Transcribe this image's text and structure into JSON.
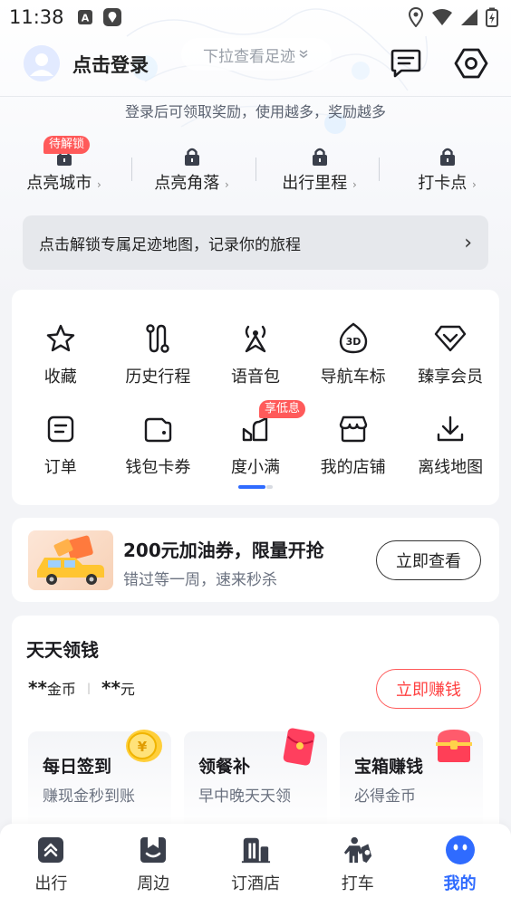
{
  "status_bar": {
    "time": "11:38"
  },
  "header": {
    "login_label": "点击登录",
    "pull_hint": "下拉查看足迹"
  },
  "login_hint": "登录后可领取奖励，使用越多，奖励越多",
  "unlock_tag": "待解锁",
  "stats": [
    {
      "label": "点亮城市"
    },
    {
      "label": "点亮角落"
    },
    {
      "label": "出行里程"
    },
    {
      "label": "打卡点"
    }
  ],
  "unlock_banner": "点击解锁专属足迹地图，记录你的旅程",
  "grid": [
    {
      "label": "收藏",
      "icon": "star-icon"
    },
    {
      "label": "历史行程",
      "icon": "route-icon"
    },
    {
      "label": "语音包",
      "icon": "voice-pack-icon"
    },
    {
      "label": "导航车标",
      "icon": "3d-car-icon"
    },
    {
      "label": "臻享会员",
      "icon": "diamond-icon"
    },
    {
      "label": "订单",
      "icon": "order-icon"
    },
    {
      "label": "钱包卡券",
      "icon": "wallet-icon"
    },
    {
      "label": "度小满",
      "icon": "duxiaoman-icon"
    },
    {
      "label": "我的店铺",
      "icon": "store-icon"
    },
    {
      "label": "离线地图",
      "icon": "download-icon"
    }
  ],
  "low_tag": "享低息",
  "promo": {
    "title": "200元加油券，限量开抢",
    "subtitle": "错过等一周，速来秒杀",
    "button": "立即查看"
  },
  "earn": {
    "title": "天天领钱",
    "coins_value": "**",
    "coins_unit": "金币",
    "cash_value": "**",
    "cash_unit": "元",
    "button": "立即赚钱",
    "tasks": [
      {
        "title": "每日签到",
        "subtitle": "赚现金秒到账",
        "icon": "gold-coin-icon"
      },
      {
        "title": "领餐补",
        "subtitle": "早中晚天天领",
        "icon": "red-envelope-icon"
      },
      {
        "title": "宝箱赚钱",
        "subtitle": "必得金币",
        "icon": "treasure-chest-icon"
      }
    ]
  },
  "tabs": [
    {
      "label": "出行",
      "icon": "travel-icon"
    },
    {
      "label": "周边",
      "icon": "nearby-icon"
    },
    {
      "label": "订酒店",
      "icon": "hotel-icon"
    },
    {
      "label": "打车",
      "icon": "taxi-icon"
    },
    {
      "label": "我的",
      "icon": "profile-icon",
      "active": true
    }
  ],
  "colors": {
    "accent": "#2f6bff",
    "tag_red": "#ff5a5a",
    "earn_red": "#ff4242"
  }
}
